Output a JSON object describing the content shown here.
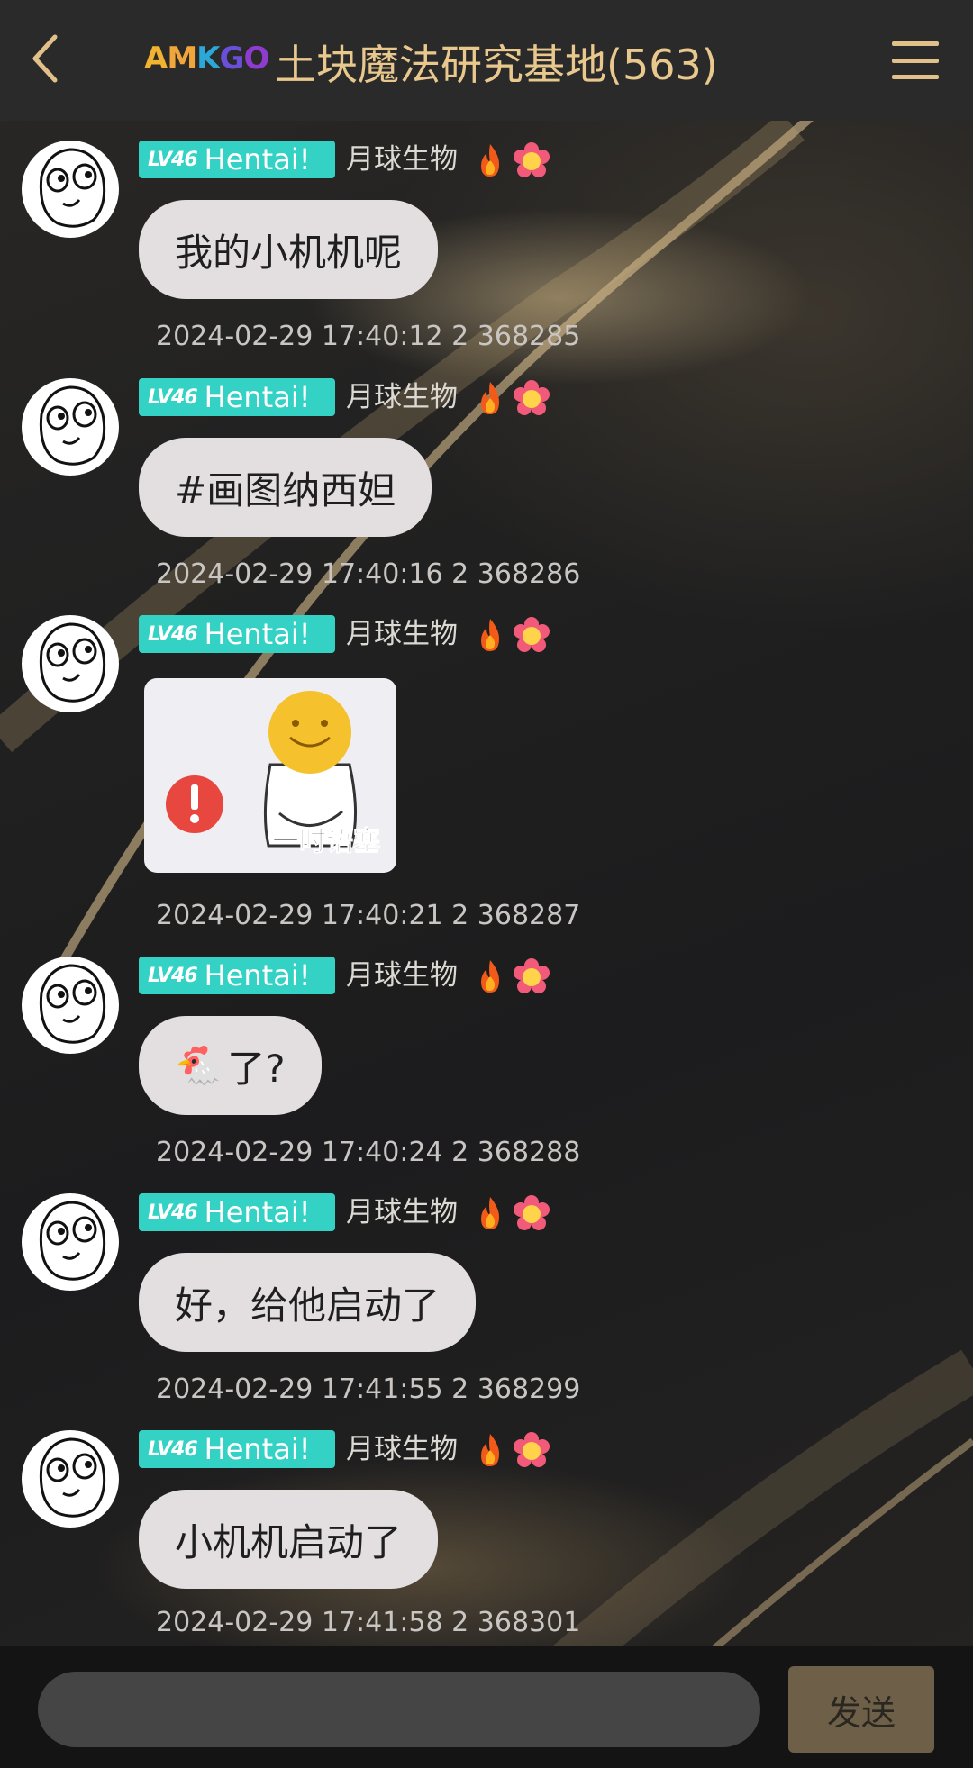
{
  "header": {
    "logo_text": "AMKGO",
    "title": "土块魔法研究基地(563)"
  },
  "colors": {
    "header_bg": "#2b2a2a",
    "title": "#e9c88e",
    "level_tag": "#34d2c4",
    "bubble": "#e3dedf",
    "send_button": "#6e6048"
  },
  "messages": [
    {
      "level": "LV46",
      "tag": "Hentai!",
      "username": "月球生物",
      "badges": [
        "fire-icon",
        "flower-emoji-icon"
      ],
      "text": "我的小机机呢",
      "meta": "2024-02-29 17:40:12 2 368285"
    },
    {
      "level": "LV46",
      "tag": "Hentai!",
      "username": "月球生物",
      "badges": [
        "fire-icon",
        "flower-emoji-icon"
      ],
      "text": "#画图纳西妲",
      "meta": "2024-02-29 17:40:16 2 368286"
    },
    {
      "level": "LV46",
      "tag": "Hentai!",
      "username": "月球生物",
      "badges": [
        "fire-icon",
        "flower-emoji-icon"
      ],
      "sticker_caption": "一时语塞",
      "meta": "2024-02-29 17:40:21 2 368287"
    },
    {
      "level": "LV46",
      "tag": "Hentai!",
      "username": "月球生物",
      "badges": [
        "fire-icon",
        "flower-emoji-icon"
      ],
      "emoji": "🐔",
      "text": "了?",
      "meta": "2024-02-29 17:40:24 2 368288"
    },
    {
      "level": "LV46",
      "tag": "Hentai!",
      "username": "月球生物",
      "badges": [
        "fire-icon",
        "flower-emoji-icon"
      ],
      "text": "好，给他启动了",
      "meta": "2024-02-29 17:41:55 2 368299"
    },
    {
      "level": "LV46",
      "tag": "Hentai!",
      "username": "月球生物",
      "badges": [
        "fire-icon",
        "flower-emoji-icon"
      ],
      "text": "小机机启动了",
      "meta": "2024-02-29 17:41:58 2 368301"
    }
  ],
  "composer": {
    "input_value": "",
    "send_label": "发送"
  }
}
